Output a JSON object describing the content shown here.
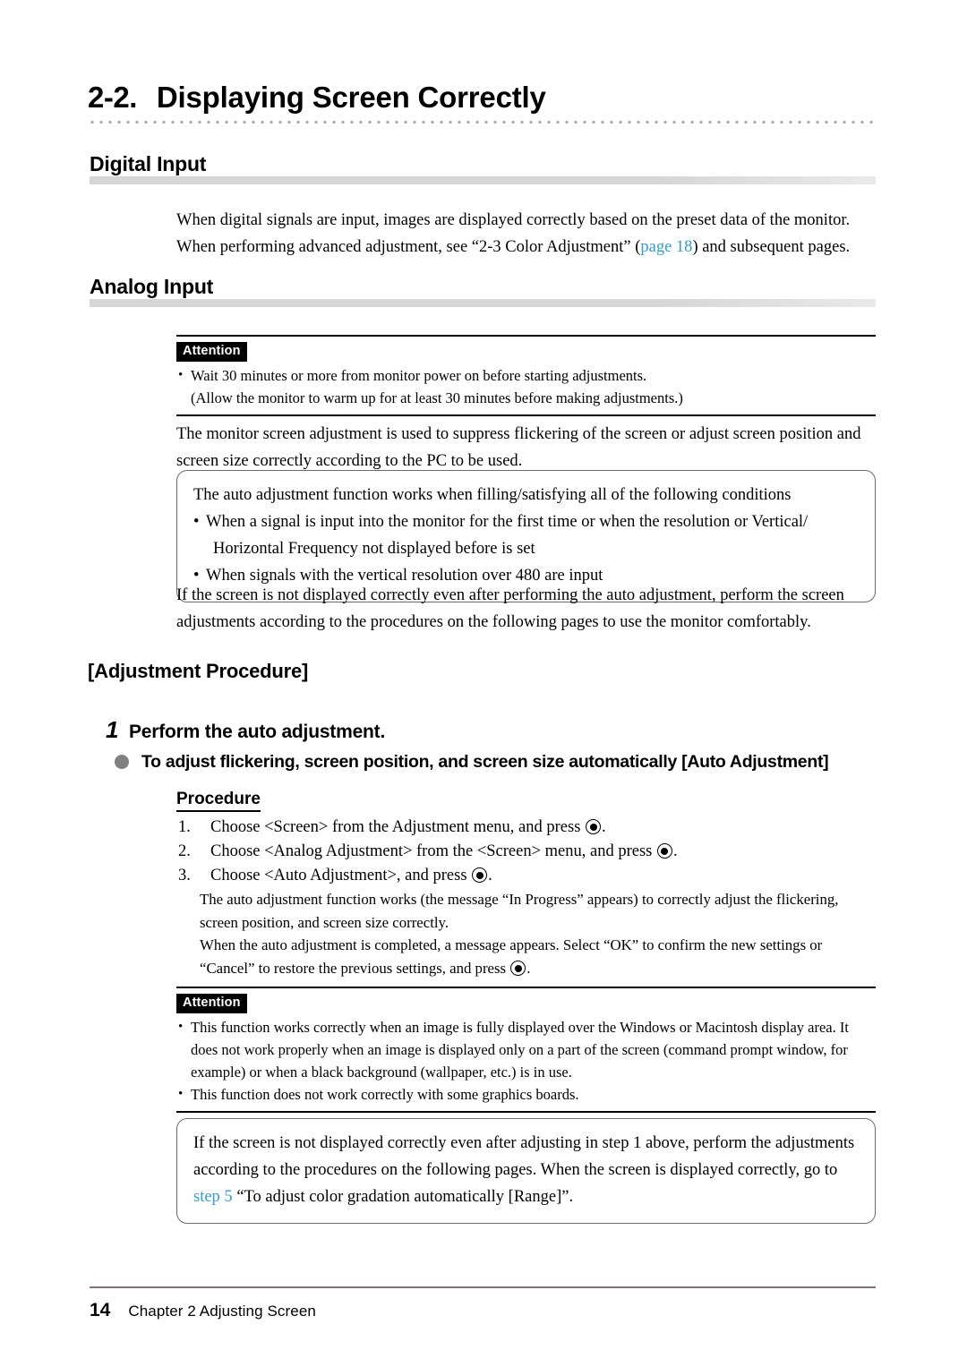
{
  "title": {
    "number": "2-2.",
    "text": "Displaying Screen Correctly"
  },
  "sections": {
    "digital": {
      "heading": "Digital Input",
      "para_line1": "When digital signals are input, images are displayed correctly based on the preset data of the monitor.",
      "para_line2_a": "When performing advanced adjustment, see “2-3 Color Adjustment” (",
      "para_line2_link": "page 18",
      "para_line2_b": ") and subsequent pages."
    },
    "analog": {
      "heading": "Analog Input"
    }
  },
  "attention1": {
    "badge": "Attention",
    "items": [
      "Wait 30 minutes or more from monitor power on before starting adjustments.",
      "(Allow the monitor to warm up for at least 30 minutes before making adjustments.)"
    ]
  },
  "intro_para": "The monitor screen adjustment is used to suppress flickering of the screen or adjust screen position and screen size correctly according to the PC to be used.",
  "conditions_box": {
    "intro": "The auto adjustment function works when filling/satisfying all of the following conditions",
    "items": [
      "When a signal is input into the monitor for the first time or when the resolution or Vertical/",
      "Horizontal Frequency not displayed before is set",
      "When signals with the vertical resolution over 480 are input"
    ]
  },
  "after_box_para": "If the screen is not displayed correctly even after performing the auto adjustment, perform the screen adjustments according to the procedures on the following pages to use the monitor comfortably.",
  "adjustment_procedure_heading": "[Adjustment Procedure]",
  "step1": {
    "number": "1",
    "text": "Perform the auto adjustment."
  },
  "auto_adjustment_bullet": "To adjust flickering, screen position, and screen size automatically [Auto Adjustment]",
  "procedure": {
    "heading": "Procedure",
    "steps": [
      {
        "n": "1.",
        "before": "Choose <Screen> from the Adjustment menu, and press",
        "after": "."
      },
      {
        "n": "2.",
        "before": "Choose <Analog Adjustment> from the <Screen> menu, and press",
        "after": "."
      },
      {
        "n": "3.",
        "before": "Choose <Auto Adjustment>, and press",
        "after": "."
      }
    ],
    "note1": "The auto adjustment function works (the message “In Progress” appears) to correctly adjust the flickering, screen position, and screen size correctly.",
    "note2_before": "When the auto adjustment is completed, a message appears. Select “OK” to confirm the new settings or “Cancel” to restore the previous settings, and press",
    "note2_after": "."
  },
  "attention2": {
    "badge": "Attention",
    "items": [
      "This function works correctly when an image is fully displayed over the Windows or Macintosh display area. It does not work properly when an image is displayed only on a part of the screen (command prompt window, for example) or when a black background (wallpaper, etc.) is in use.",
      "This function does not work correctly with some graphics boards."
    ]
  },
  "final_box": {
    "text_a": "If the screen is not displayed correctly even after adjusting in step 1 above, perform the adjustments according to the procedures on the following pages. When the screen is displayed correctly, go to ",
    "link": "step 5",
    "text_b": " “To adjust color gradation automatically [Range]”."
  },
  "footer": {
    "page": "14",
    "chapter": "Chapter 2  Adjusting Screen"
  },
  "colors": {
    "link": "#2f9fd0",
    "bullet_gray": "#808080",
    "heading_rule": "#d6d6d6",
    "footer_rule": "#8a7070"
  }
}
